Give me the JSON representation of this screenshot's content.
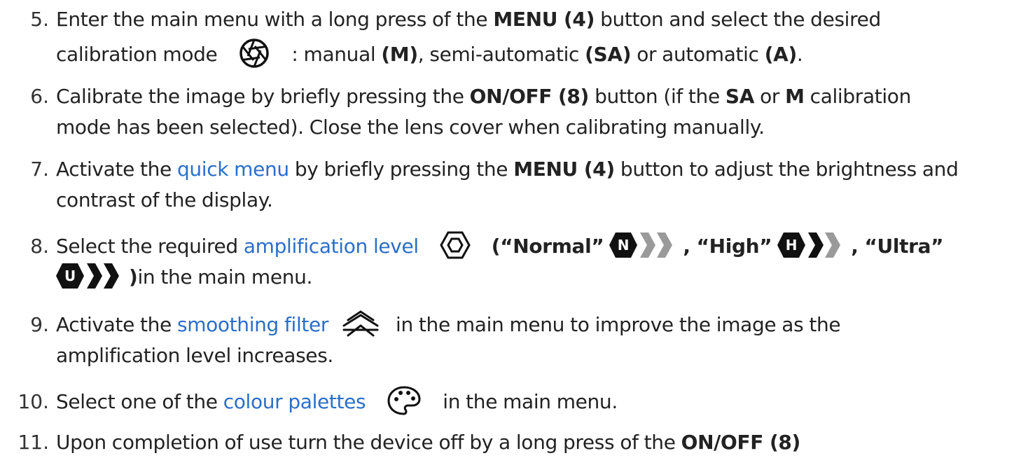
{
  "steps": [
    {
      "number": "5.",
      "line1_a": "Enter the main menu with a long press of the ",
      "line1_b": "MENU (4)",
      "line1_c": " button and select the desired",
      "line2_a": "calibration mode",
      "icon": "calibration-shutter-icon",
      "line2_b": ": manual ",
      "line2_c": "(M)",
      "line2_d": ", semi-automatic ",
      "line2_e": "(SA)",
      "line2_f": " or automatic ",
      "line2_g": "(A)",
      "line2_h": "."
    },
    {
      "number": "6.",
      "line1_a": "Calibrate the image by briefly pressing the ",
      "line1_b": "ON/OFF (8)",
      "line1_c": " button (if the ",
      "line1_d": "SA",
      "line1_e": " or ",
      "line1_f": "M",
      "line1_g": " calibration",
      "line2": "mode has been selected). Close the lens cover when calibrating manually."
    },
    {
      "number": "7.",
      "line1_a": "Activate the ",
      "link": "quick menu",
      "line1_b": " by briefly pressing the ",
      "line1_c": "MENU (4)",
      "line1_d": " button to adjust the brightness and",
      "line2": "contrast of the display."
    },
    {
      "number": "8.",
      "line1_a": "Select the required ",
      "link": "amplification level",
      "icon": "amplification-hexagon-icon",
      "line1_b": "(",
      "normal_label": "“Normal”",
      "normal_badge": "N",
      "high_label": "“High”",
      "high_badge": "H",
      "ultra_label": "“Ultra”",
      "ultra_badge": "U",
      "sep1": " , ",
      "sep2": " , ",
      "line2_a": ")",
      "line2_b": "in the main menu."
    },
    {
      "number": "9.",
      "line1_a": "Activate the ",
      "link": "smoothing filter",
      "icon": "smoothing-filter-icon",
      "line1_b": "in the main menu to improve the image as the",
      "line2": "amplification level increases."
    },
    {
      "number": "10.",
      "line1_a": "Select one of the ",
      "link": "colour palettes",
      "icon": "palette-icon",
      "line1_b": "in the main menu."
    },
    {
      "number": "11.",
      "line1_a": "Upon completion of use turn the device off by a long press of the ",
      "line1_b": "ON/OFF (8)"
    }
  ],
  "colors": {
    "text": "#222222",
    "link": "#2a6ec9",
    "badge_dark": "#111111",
    "chevron_gray": "#9a9a9a"
  }
}
